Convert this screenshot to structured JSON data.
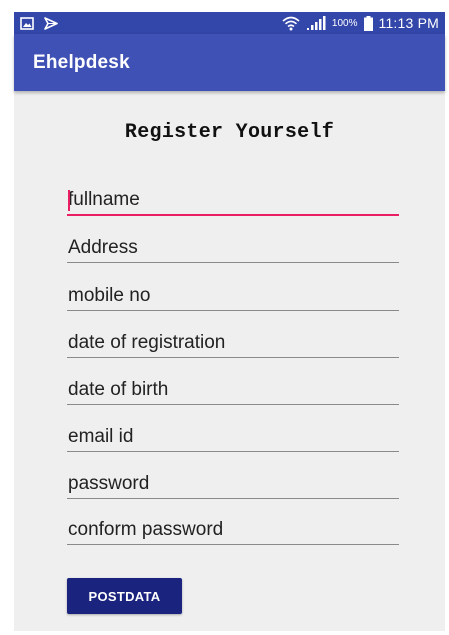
{
  "status_bar": {
    "battery_percent": "100%",
    "time": "11:13 PM"
  },
  "app_bar": {
    "title": "Ehelpdesk"
  },
  "form": {
    "heading": "Register Yourself",
    "fields": [
      {
        "placeholder": "fullname"
      },
      {
        "placeholder": "Address"
      },
      {
        "placeholder": "mobile no"
      },
      {
        "placeholder": "date of registration"
      },
      {
        "placeholder": "date of birth"
      },
      {
        "placeholder": "email id"
      },
      {
        "placeholder": "password"
      },
      {
        "placeholder": "conform password"
      }
    ],
    "submit_label": "POSTDATA"
  },
  "colors": {
    "status_bar": "#3346a9",
    "app_bar": "#3f51b5",
    "accent": "#e91e63",
    "button": "#1a237e",
    "background": "#efefef"
  },
  "icons": [
    "image-notification-icon",
    "cast-notification-icon",
    "wifi-icon",
    "signal-icon",
    "battery-icon"
  ]
}
